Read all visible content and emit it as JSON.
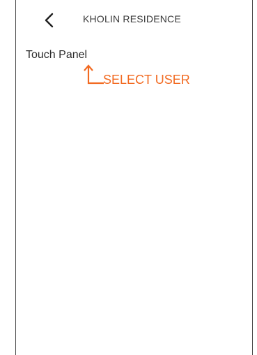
{
  "header": {
    "title": "KHOLIN RESIDENCE",
    "back_icon": "chevron-left-icon"
  },
  "list": {
    "items": [
      {
        "label": "Touch Panel"
      }
    ]
  },
  "annotation": {
    "text": "SELECT USER",
    "color": "#f26a21",
    "icon": "up-arrow-icon"
  }
}
